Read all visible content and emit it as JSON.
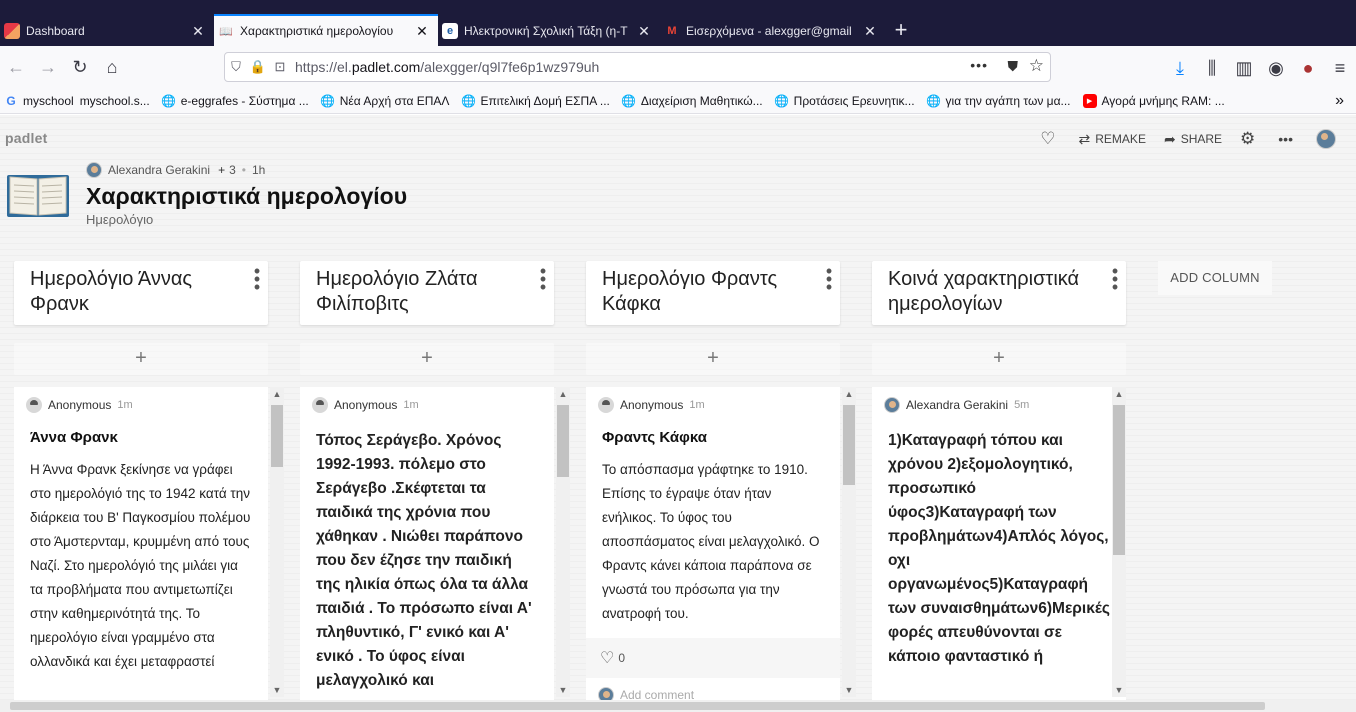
{
  "browser": {
    "tabs": [
      {
        "label": "Dashboard",
        "icon": "moodle-icon",
        "active": false
      },
      {
        "label": "Χαρακτηριστικά ημερολογίου",
        "icon": "book-icon",
        "active": true
      },
      {
        "label": "Ηλεκτρονική Σχολική Τάξη (η-Τ",
        "icon": "eclass-icon",
        "active": false
      },
      {
        "label": "Εισερχόμενα - alexgger@gmail",
        "icon": "gmail-icon",
        "active": false
      }
    ],
    "url_prefix": "https://el.",
    "url_host": "padlet.com",
    "url_path": "/alexgger/q9l7fe6p1wz979uh",
    "bookmarks": [
      {
        "label": "myschool",
        "icon": "google-icon"
      },
      {
        "label": "myschool.s...",
        "icon": ""
      },
      {
        "label": "e-eggrafes - Σύστημα ...",
        "icon": "globe-icon"
      },
      {
        "label": "Νέα Αρχή στα ΕΠΑΛ",
        "icon": "globe-icon"
      },
      {
        "label": "Επιτελική Δομή ΕΣΠΑ ...",
        "icon": "globe-icon"
      },
      {
        "label": "Διαχείριση Μαθητικώ...",
        "icon": "globe-icon"
      },
      {
        "label": "Προτάσεις Ερευνητικ...",
        "icon": "globe-icon"
      },
      {
        "label": "για την αγάπη των μα...",
        "icon": "globe-icon"
      },
      {
        "label": "Αγορά μνήμης RAM: ...",
        "icon": "youtube-icon"
      }
    ]
  },
  "padlet": {
    "logo": "padlet",
    "actions": {
      "remake": "REMAKE",
      "share": "SHARE"
    },
    "author": "Alexandra Gerakini",
    "contributors": "3",
    "age": "1h",
    "title": "Χαρακτηριστικά ημερολογίου",
    "subtitle": "Ημερολόγιο",
    "add_column": "ADD COLUMN",
    "add_symbol": "+",
    "columns": [
      {
        "title": "Ημερολόγιο Άννας Φρανκ",
        "post": {
          "author": "Anonymous",
          "time": "1m",
          "title": "Άννα Φρανκ",
          "body": "Η Άννα Φρανκ ξεκίνησε να γράφει στο ημερολόγιό της το 1942 κατά την διάρκεια του Β' Παγκοσμίου πολέμου στο Άμστερνταμ, κρυμμένη από τους Ναζί.  Στο ημερολόγιό της μιλάει για τα προβλήματα που αντιμετωπίζει στην καθημερινότητά της. Το ημερολόγιο είναι γραμμένο στα ολλανδικά και έχει μεταφραστεί"
        }
      },
      {
        "title": "Ημερολόγιο Ζλάτα Φιλίποβιτς",
        "post": {
          "author": "Anonymous",
          "time": "1m",
          "title": "",
          "body": "Τόπος Σεράγεβο. Χρόνος 1992-1993. πόλεμο στο Σεράγεβο .Σκέφτεται τα παιδικά της χρόνια που χάθηκαν . Νιώθει παράπονο που δεν έζησε την παιδική της ηλικία όπως όλα τα άλλα παιδιά . Το πρόσωπο είναι Α' πληθυντικό, Γ' ενικό και Α' ενικό . Το ύφος είναι μελαγχολικό και"
        }
      },
      {
        "title": "Ημερολόγιο Φραντς Κάφκα",
        "post": {
          "author": "Anonymous",
          "time": "1m",
          "title": "Φραντς Κάφκα",
          "body": "Το απόσπασμα  γράφτηκε το 1910. Επίσης το έγραψε όταν ήταν ενήλικος. Το ύφος του αποσπάσματος είναι μελαγχολικό. Ο Φραντς κάνει κάποια παράπονα σε γνωστά του πρόσωπα για την ανατροφή του.",
          "likes": "0",
          "comment_placeholder": "Add comment"
        }
      },
      {
        "title": "Κοινά χαρακτηριστικά ημερολογίων",
        "post": {
          "author": "Alexandra Gerakini",
          "time": "5m",
          "title": "",
          "body": "1)Καταγραφή τόπου και χρόνου 2)εξομολογητικό, προσωπικό ύφος3)Καταγραφή των προβλημάτων4)Απλός λόγος, οχι οργανωμένος5)Καταγραφή των συναισθημάτων6)Μερικές φορές απευθύνονται σε κάποιο φανταστικό ή"
        }
      }
    ]
  }
}
